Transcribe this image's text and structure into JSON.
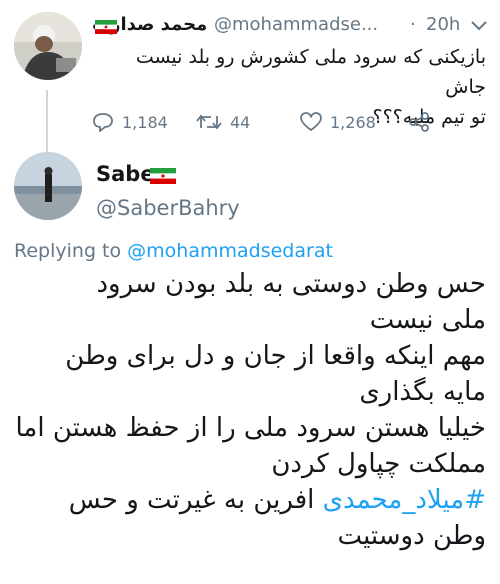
{
  "tweet1": {
    "name": "محمد صدارت",
    "handle": "@mohammadse...",
    "separator": "·",
    "time": "20h",
    "text_line1": "بازیکنی که سرود ملی کشورش رو بلد نیست جاش",
    "text_line2": "تو تیم ملیه؟؟؟",
    "replies": "1,184",
    "retweets": "44",
    "likes": "1,268"
  },
  "tweet2": {
    "name": "Saber",
    "handle": "@SaberBahry",
    "replying_prefix": "Replying to",
    "replying_to": "@mohammadsedarat",
    "line1": "حس وطن دوستی به بلد بودن سرود",
    "line2": "ملی نیست",
    "line3": "مهم اینکه واقعا از جان و دل برای وطن",
    "line4": "مایه بگذاری",
    "line5": "خیلیا هستن سرود ملی را از حفظ هستن اما",
    "line6": "مملکت چپاول کردن",
    "hashtag": "#میلاد_محمدی",
    "line7_rest": "افرین به غیرتت و حس",
    "line8": "وطن دوستیت"
  },
  "colors": {
    "link": "#1da1f2",
    "muted": "#657786",
    "text": "#14171a",
    "thread_line": "#ccd6dd"
  }
}
